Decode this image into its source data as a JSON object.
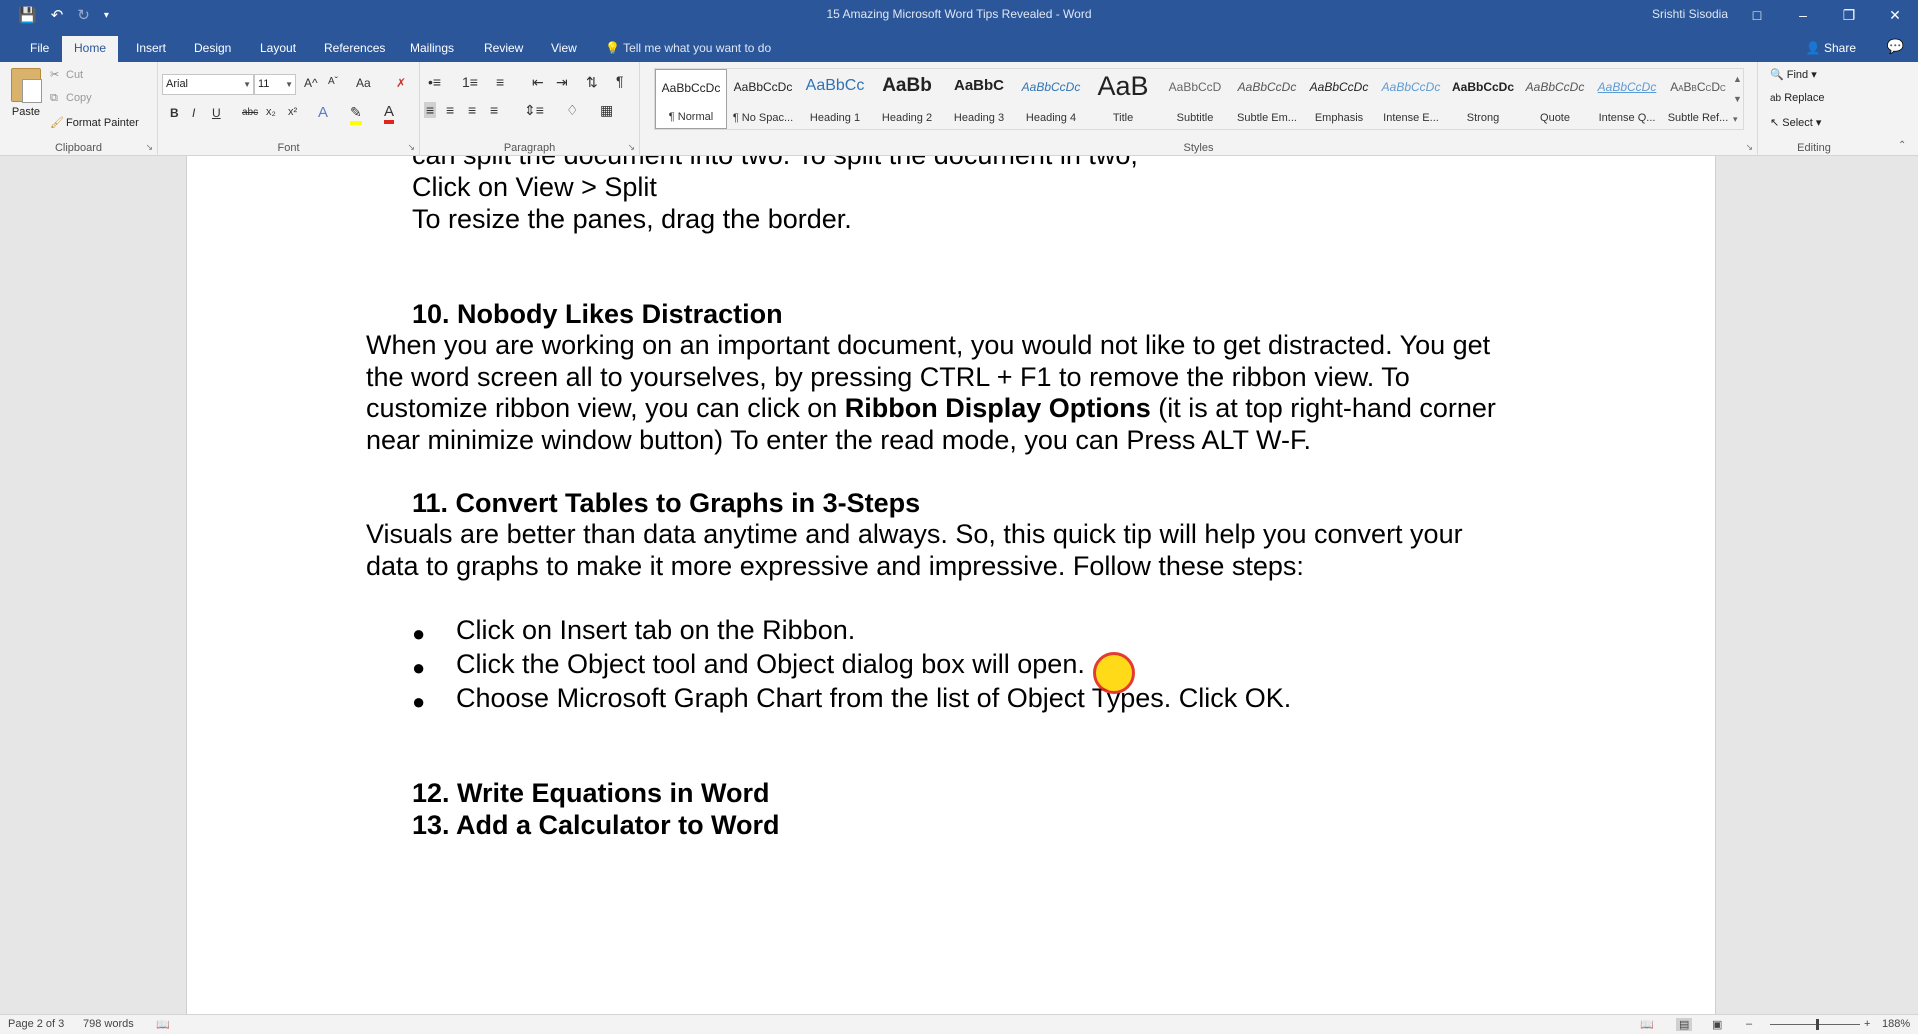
{
  "titlebar": {
    "doc_title": "15 Amazing Microsoft Word Tips Revealed  -  Word",
    "user": "Srishti Sisodia",
    "icons": [
      "save-icon",
      "undo-icon",
      "redo-icon",
      "customize-qat-icon"
    ]
  },
  "tabs": [
    {
      "label": "File"
    },
    {
      "label": "Home",
      "active": true
    },
    {
      "label": "Insert"
    },
    {
      "label": "Design"
    },
    {
      "label": "Layout"
    },
    {
      "label": "References"
    },
    {
      "label": "Mailings"
    },
    {
      "label": "Review"
    },
    {
      "label": "View"
    }
  ],
  "tell_me": "Tell me what you want to do",
  "share": "Share",
  "clipboard": {
    "paste": "Paste",
    "cut": "Cut",
    "copy": "Copy",
    "format_painter": "Format Painter",
    "label": "Clipboard"
  },
  "font": {
    "family": "Arial",
    "size": "11",
    "label": "Font",
    "bold": "B",
    "italic": "I",
    "underline": "U",
    "strike": "abc",
    "sub": "x₂",
    "sup": "x²",
    "grow": "A^",
    "shrink": "Aˇ",
    "case": "Aa"
  },
  "paragraph": {
    "label": "Paragraph"
  },
  "styles": {
    "label": "Styles",
    "items": [
      {
        "preview": "AaBbCcDc",
        "name": "¶ Normal"
      },
      {
        "preview": "AaBbCcDc",
        "name": "¶ No Spac..."
      },
      {
        "preview": "AaBbCc",
        "name": "Heading 1"
      },
      {
        "preview": "AaBb",
        "name": "Heading 2"
      },
      {
        "preview": "AaBbC",
        "name": "Heading 3"
      },
      {
        "preview": "AaBbCcDc",
        "name": "Heading 4"
      },
      {
        "preview": "AaB",
        "name": "Title"
      },
      {
        "preview": "AaBbCcD",
        "name": "Subtitle"
      },
      {
        "preview": "AaBbCcDc",
        "name": "Subtle Em..."
      },
      {
        "preview": "AaBbCcDc",
        "name": "Emphasis"
      },
      {
        "preview": "AaBbCcDc",
        "name": "Intense E..."
      },
      {
        "preview": "AaBbCcDc",
        "name": "Strong"
      },
      {
        "preview": "AaBbCcDc",
        "name": "Quote"
      },
      {
        "preview": "AaBbCcDc",
        "name": "Intense Q..."
      },
      {
        "preview": "AaBbCcDc",
        "name": "Subtle Ref..."
      }
    ]
  },
  "editing": {
    "find": "Find",
    "replace": "Replace",
    "select": "Select",
    "label": "Editing"
  },
  "document": {
    "line_top_partial": "can split the document into two. To split the document in two,",
    "line_view_split": "Click on View > Split",
    "line_resize": "To resize the panes, drag the border.",
    "h10": "10. Nobody Likes Distraction",
    "p10_1": "When you are working on an important document, you would not like to get distracted. You get",
    "p10_2": "the word screen all to yourselves, by pressing CTRL + F1 to remove the ribbon view. To",
    "p10_3a": "customize ribbon view, you can click on ",
    "p10_3b": "Ribbon Display Options",
    "p10_3c": " (it is at top right-hand corner",
    "p10_4": "near minimize window button) To enter the read mode, you can Press ALT W-F.",
    "h11": "11. Convert Tables to Graphs in 3-Steps",
    "p11_1": "Visuals are better than data anytime and always. So, this quick tip will help you convert your",
    "p11_2": "data to graphs to make it more expressive and impressive. Follow these steps:",
    "bullets": [
      "Click on Insert tab on the Ribbon.",
      "Click the Object tool and Object dialog box will open.",
      "Choose Microsoft Graph Chart from the list of Object Types. Click OK."
    ],
    "h12": "12. Write Equations in Word",
    "h13": "13. Add a Calculator to Word"
  },
  "status": {
    "page": "Page 2 of 3",
    "words": "798 words",
    "zoom": "188%"
  },
  "colors": {
    "accent": "#2b579a",
    "cursor_fill": "#ffd700",
    "cursor_ring": "#e0261b"
  }
}
